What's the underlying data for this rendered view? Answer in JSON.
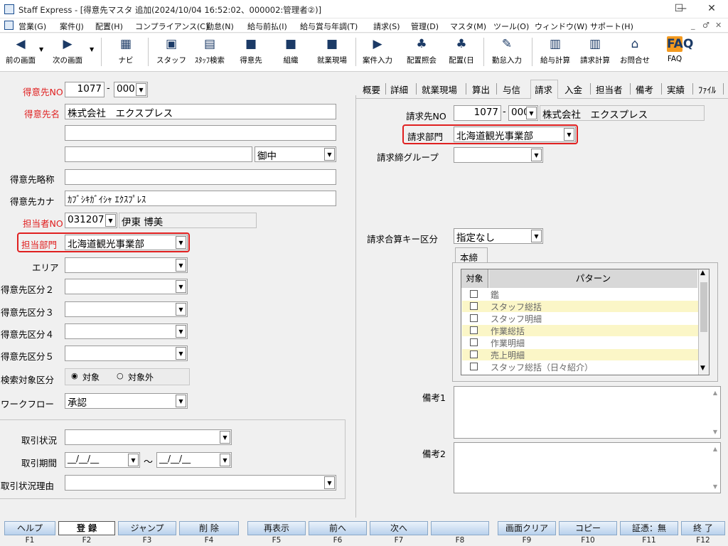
{
  "window": {
    "title": "Staff Express - [得意先マスタ 追加(2024/10/04 16:52:02、000002:管理者②)]",
    "min": "—",
    "max": "☐",
    "close": "✕"
  },
  "menu": [
    "営業(G)",
    "案件(J)",
    "配置(H)",
    "コンプライアンス(C)",
    "勤怠(N)",
    "給与前払(I)",
    "給与賞与年調(T)",
    "請求(S)",
    "管理(D)",
    "マスタ(M)",
    "ツール(O)",
    "ウィンドウ(W)",
    "サポート(H)"
  ],
  "mdi_controls": [
    "_",
    "♂",
    "✕"
  ],
  "toolbar": [
    {
      "label": "前の画面",
      "icon": "back-arrow-icon"
    },
    {
      "label": "次の画面",
      "icon": "forward-arrow-icon"
    },
    {
      "label": "ナビ",
      "icon": "navi-icon"
    },
    {
      "label": "スタッフ",
      "icon": "staff-icon"
    },
    {
      "label": "ｽﾀｯﾌ検索",
      "icon": "staff-search-icon"
    },
    {
      "label": "得意先",
      "icon": "customer-icon"
    },
    {
      "label": "組織",
      "icon": "organization-icon"
    },
    {
      "label": "就業現場",
      "icon": "worksite-icon"
    },
    {
      "label": "案件入力",
      "icon": "project-entry-icon"
    },
    {
      "label": "配置照会",
      "icon": "placement-inquiry-icon"
    },
    {
      "label": "配置(日",
      "icon": "placement-daily-icon"
    },
    {
      "label": "勤怠入力",
      "icon": "attendance-entry-icon"
    },
    {
      "label": "給与計算",
      "icon": "payroll-icon"
    },
    {
      "label": "請求計算",
      "icon": "billing-calc-icon"
    },
    {
      "label": "お問合せ",
      "icon": "inquiry-icon"
    },
    {
      "label": "FAQ",
      "icon": "faq-icon"
    }
  ],
  "left": {
    "customer_no_label": "得意先NO",
    "customer_no": "1077",
    "dash": "-",
    "customer_branch": "000",
    "customer_name_label": "得意先名",
    "customer_name": "株式会社　エクスプレス",
    "honorific": "御中",
    "short_name_label": "得意先略称",
    "kana_label": "得意先カナ",
    "kana": "ｶﾌﾞｼｷｶﾞｲｼｬ ｴｸｽﾌﾟﾚｽ",
    "staff_no_label": "担当者NO",
    "staff_no": "031207",
    "staff_name": "伊東 博美",
    "dept_label": "担当部門",
    "dept": "北海道観光事業部",
    "area_label": "エリア",
    "class2_label": "得意先区分２",
    "class3_label": "得意先区分３",
    "class4_label": "得意先区分４",
    "class5_label": "得意先区分５",
    "search_label": "検索対象区分",
    "radio_on": "対象",
    "radio_off": "対象外",
    "workflow_label": "ワークフロー",
    "workflow": "承認",
    "trade_status_label": "取引状況",
    "trade_period_label": "取引期間",
    "date_placeholder": "__/__/__",
    "tilde": "～",
    "trade_reason_label": "取引状況理由"
  },
  "tabs": [
    "概要",
    "詳細",
    "就業現場",
    "算出",
    "与信",
    "請求",
    "入金",
    "担当者",
    "備考",
    "実績",
    "ﾌｧｲﾙ"
  ],
  "active_tab": 5,
  "right": {
    "billing_no_label": "請求先NO",
    "billing_no": "1077",
    "billing_branch": "000",
    "billing_name": "株式会社　エクスプレス",
    "billing_dept_label": "請求部門",
    "billing_dept": "北海道観光事業部",
    "closing_group_label": "請求締グループ",
    "sum_key_label": "請求合算キー区分",
    "sum_key": "指定なし",
    "subtab": "本締",
    "grid_header_check": "対象",
    "grid_header_pattern": "パターン",
    "patterns": [
      "鑑",
      "スタッフ総括",
      "スタッフ明細",
      "作業総括",
      "作業明細",
      "売上明細",
      "スタッフ総括（日々紹介）"
    ],
    "note1_label": "備考1",
    "note2_label": "備考2"
  },
  "fkeys": [
    {
      "label": "ヘルプ",
      "key": "F1"
    },
    {
      "label": "登 録",
      "key": "F2"
    },
    {
      "label": "ジャンプ",
      "key": "F3"
    },
    {
      "label": "削 除",
      "key": "F4"
    },
    {
      "label": "再表示",
      "key": "F5"
    },
    {
      "label": "前へ",
      "key": "F6"
    },
    {
      "label": "次へ",
      "key": "F7"
    },
    {
      "label": "",
      "key": "F8"
    },
    {
      "label": "画面クリア",
      "key": "F9"
    },
    {
      "label": "コピー",
      "key": "F10"
    },
    {
      "label": "証憑：無",
      "key": "F11"
    },
    {
      "label": "終 了",
      "key": "F12"
    }
  ],
  "colors": {
    "accent_red": "#e02020",
    "grid_yellow": "#fbf6c7",
    "fkey_blue": "#b9d1ec"
  }
}
